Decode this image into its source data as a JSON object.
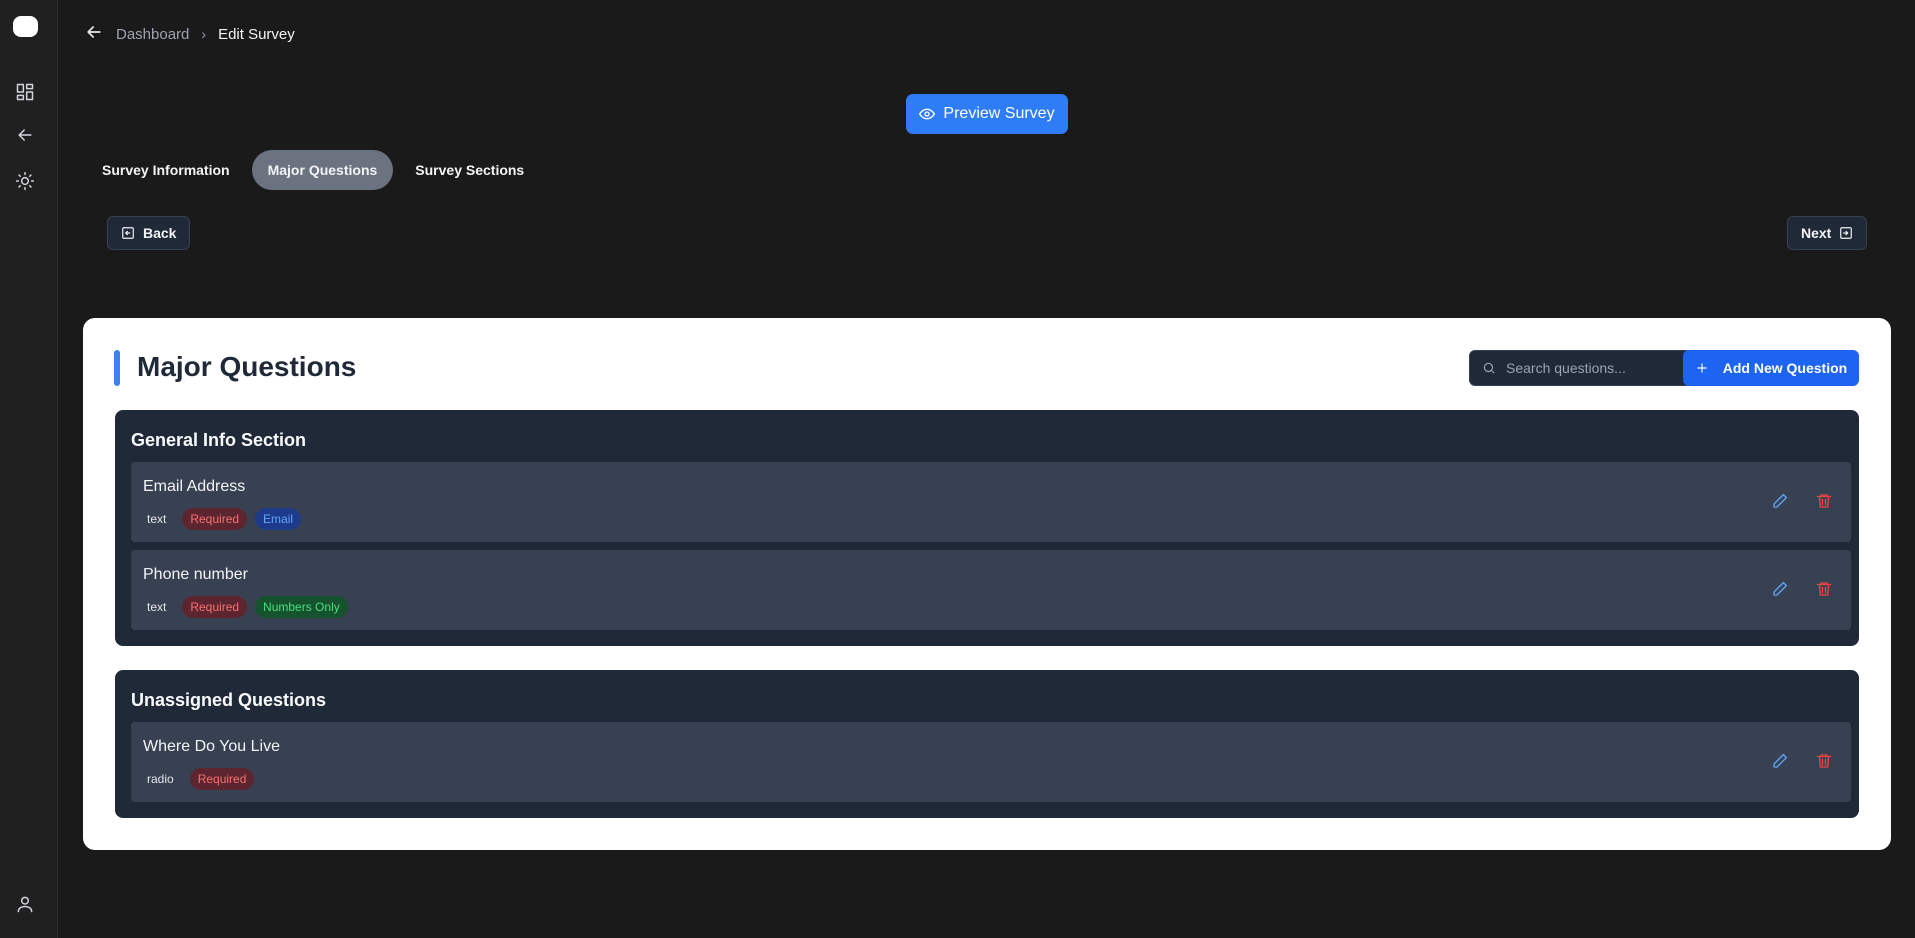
{
  "breadcrumb": {
    "parent": "Dashboard",
    "separator": "›",
    "current": "Edit Survey"
  },
  "preview_button": "Preview Survey",
  "tabs": [
    {
      "label": "Survey Information",
      "active": false
    },
    {
      "label": "Major Questions",
      "active": true
    },
    {
      "label": "Survey Sections",
      "active": false
    }
  ],
  "nav": {
    "back_label": "Back",
    "next_label": "Next"
  },
  "card": {
    "title": "Major Questions",
    "search_placeholder": "Search questions...",
    "add_label": "Add New Question"
  },
  "sections": [
    {
      "title": "General Info Section",
      "questions": [
        {
          "title": "Email Address",
          "type": "text",
          "required": "Required",
          "validation": "Email"
        },
        {
          "title": "Phone number",
          "type": "text",
          "required": "Required",
          "validation": "Numbers Only"
        }
      ]
    },
    {
      "title": "Unassigned Questions",
      "questions": [
        {
          "title": "Where Do You Live",
          "type": "radio",
          "required": "Required"
        }
      ]
    }
  ],
  "colors": {
    "accent": "#2f7df6",
    "primary": "#1d64f2",
    "page_bg": "#1a1a1a",
    "section_bg": "#1f2937",
    "row_bg": "#374151",
    "danger": "#ef4444"
  },
  "icons": [
    "logo",
    "dashboard-icon",
    "arrow-left-icon",
    "sun-icon",
    "user-icon",
    "eye-icon",
    "search-icon",
    "plus-icon",
    "edit-icon",
    "delete-icon"
  ]
}
